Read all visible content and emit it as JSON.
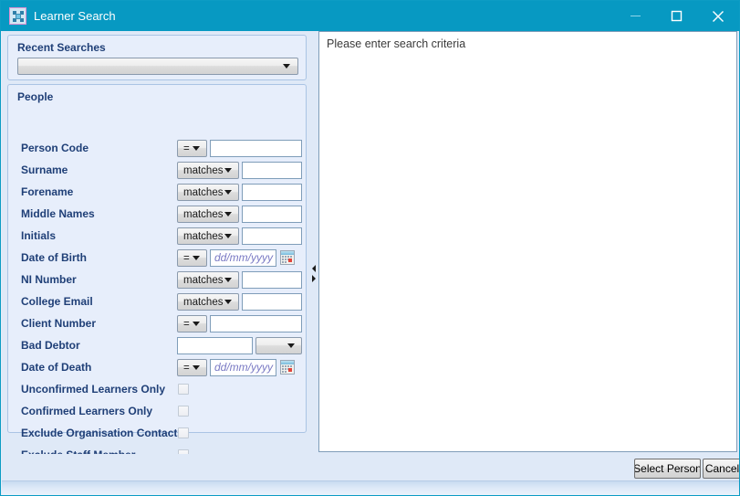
{
  "window": {
    "title": "Learner Search",
    "icon": "app-grid-icon",
    "controls": {
      "minimize": "minimize-icon",
      "maximize": "maximize-icon",
      "close": "close-icon"
    },
    "accent_color": "#0799c2",
    "pane_background": "#dfe9f7",
    "label_color": "#1f3f77"
  },
  "recent_searches": {
    "title": "Recent Searches",
    "combo_value": "",
    "combo_placeholder": ""
  },
  "people": {
    "title": "People",
    "rows": [
      {
        "label": "Person Code",
        "type": "operator-text",
        "operator": "=",
        "value": ""
      },
      {
        "label": "Surname",
        "type": "operator-text",
        "operator": "matches",
        "value": ""
      },
      {
        "label": "Forename",
        "type": "operator-text",
        "operator": "matches",
        "value": ""
      },
      {
        "label": "Middle Names",
        "type": "operator-text",
        "operator": "matches",
        "value": ""
      },
      {
        "label": "Initials",
        "type": "operator-text",
        "operator": "matches",
        "value": ""
      },
      {
        "label": "Date of Birth",
        "type": "operator-date",
        "operator": "=",
        "value": "",
        "placeholder": "dd/mm/yyyy"
      },
      {
        "label": "NI Number",
        "type": "operator-text",
        "operator": "matches",
        "value": ""
      },
      {
        "label": "College Email",
        "type": "operator-text",
        "operator": "matches",
        "value": ""
      },
      {
        "label": "Client Number",
        "type": "operator-text",
        "operator": "=",
        "value": ""
      },
      {
        "label": "Bad Debtor",
        "type": "text-combo",
        "value": "",
        "combo_value": ""
      },
      {
        "label": "Date of Death",
        "type": "operator-date",
        "operator": "=",
        "value": "",
        "placeholder": "dd/mm/yyyy"
      },
      {
        "label": "Unconfirmed Learners Only",
        "type": "checkbox",
        "checked": false
      },
      {
        "label": "Confirmed Learners Only",
        "type": "checkbox",
        "checked": false
      },
      {
        "label": "Exclude Organisation Contacts",
        "type": "checkbox",
        "checked": false
      },
      {
        "label": "Exclude Staff Member",
        "type": "checkbox",
        "checked": false
      }
    ]
  },
  "splitter": {
    "collapse_left_icon": "triangle-left-icon",
    "collapse_right_icon": "triangle-right-icon"
  },
  "results": {
    "message": "Please enter search criteria"
  },
  "footer": {
    "select_person_label": "Select Person",
    "cancel_label": "Cancel"
  }
}
